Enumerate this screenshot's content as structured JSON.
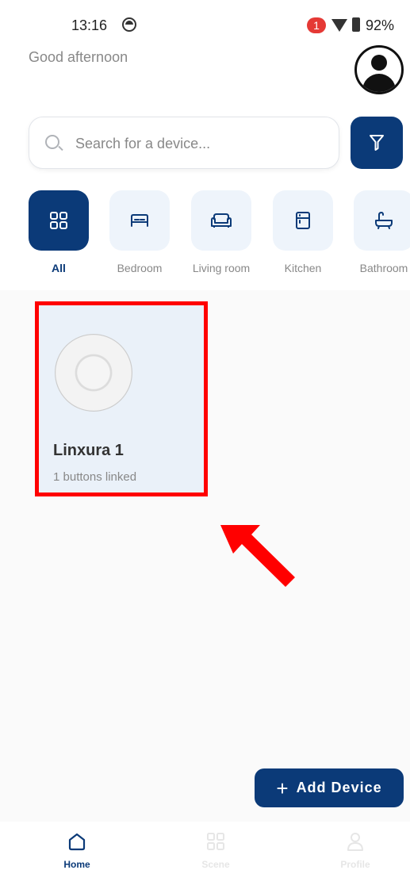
{
  "status_bar": {
    "time": "13:16",
    "notification_count": "1",
    "battery": "92%"
  },
  "header": {
    "greeting": "Good afternoon",
    "avatar_icon": "user-avatar-icon"
  },
  "search": {
    "placeholder": "Search for a device...",
    "value": "",
    "filter_icon": "filter-icon"
  },
  "categories": [
    {
      "label": "All",
      "icon": "grid-icon",
      "active": true
    },
    {
      "label": "Bedroom",
      "icon": "bed-icon",
      "active": false
    },
    {
      "label": "Living room",
      "icon": "sofa-icon",
      "active": false
    },
    {
      "label": "Kitchen",
      "icon": "fridge-icon",
      "active": false
    },
    {
      "label": "Bathroom",
      "icon": "bathtub-icon",
      "active": false
    }
  ],
  "devices": [
    {
      "name": "Linxura 1",
      "subtitle": "1 buttons linked",
      "icon": "round-controller-image"
    }
  ],
  "actions": {
    "add_device_label": "Add Device"
  },
  "bottom_nav": [
    {
      "label": "Home",
      "icon": "home-icon",
      "active": true
    },
    {
      "label": "Scene",
      "icon": "grid-icon",
      "active": false
    },
    {
      "label": "Profile",
      "icon": "person-icon",
      "active": false
    }
  ],
  "colors": {
    "primary": "#0b3a78",
    "tile_bg": "#eef4fb",
    "highlight": "#ff0000"
  }
}
